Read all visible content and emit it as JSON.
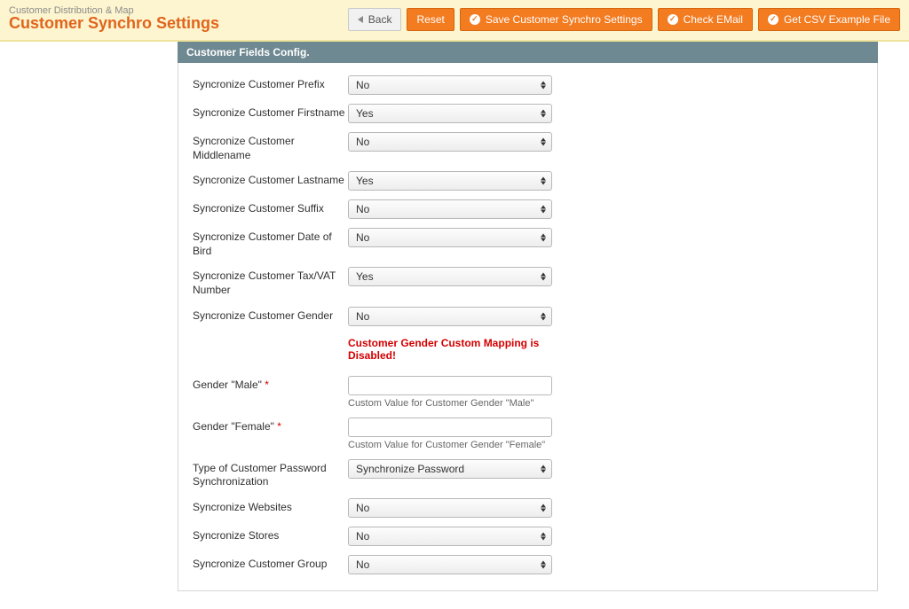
{
  "header": {
    "nav": "Customer Distribution & Map",
    "title": "Customer Synchro Settings",
    "buttons": {
      "back": "Back",
      "reset": "Reset",
      "save": "Save Customer Synchro Settings",
      "check_email": "Check EMail",
      "get_csv": "Get CSV Example File"
    }
  },
  "section": {
    "title": "Customer Fields Config."
  },
  "fields": {
    "prefix": {
      "label": "Syncronize Customer Prefix",
      "value": "No"
    },
    "firstname": {
      "label": "Syncronize Customer Firstname",
      "value": "Yes"
    },
    "middlename": {
      "label": "Syncronize Customer Middlename",
      "value": "No"
    },
    "lastname": {
      "label": "Syncronize Customer Lastname",
      "value": "Yes"
    },
    "suffix": {
      "label": "Syncronize Customer Suffix",
      "value": "No"
    },
    "dob": {
      "label": "Syncronize Customer Date of Bird",
      "value": "No"
    },
    "taxvat": {
      "label": "Syncronize Customer Tax/VAT Number",
      "value": "Yes"
    },
    "gender": {
      "label": "Syncronize Customer Gender",
      "value": "No"
    },
    "gender_warn": "Customer Gender Custom Mapping is Disabled!",
    "gender_male": {
      "label": "Gender \"Male\"",
      "value": "",
      "hint": "Custom Value for Customer Gender \"Male\""
    },
    "gender_female": {
      "label": "Gender \"Female\"",
      "value": "",
      "hint": "Custom Value for Customer Gender \"Female\""
    },
    "pw_sync": {
      "label": "Type of Customer Password Synchronization",
      "value": "Synchronize Password"
    },
    "websites": {
      "label": "Syncronize Websites",
      "value": "No"
    },
    "stores": {
      "label": "Syncronize Stores",
      "value": "No"
    },
    "group": {
      "label": "Syncronize Customer Group",
      "value": "No"
    }
  },
  "required_marker": "*"
}
